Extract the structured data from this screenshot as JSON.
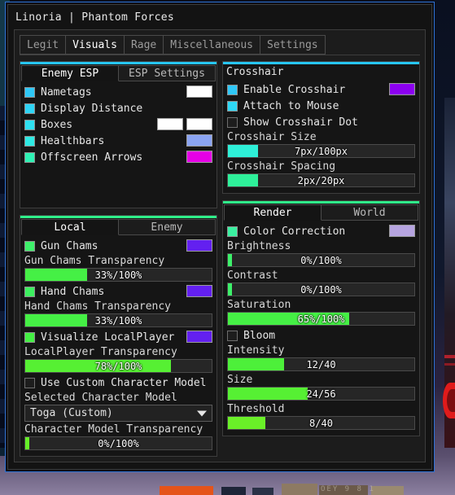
{
  "window": {
    "title": "Linoria | Phantom Forces",
    "border_color": "#2f73d8"
  },
  "main_tabs": [
    {
      "label": "Legit",
      "active": false
    },
    {
      "label": "Visuals",
      "active": true
    },
    {
      "label": "Rage",
      "active": false
    },
    {
      "label": "Miscellaneous",
      "active": false
    },
    {
      "label": "Settings",
      "active": false
    }
  ],
  "left_column": {
    "esp_group": {
      "accent_color": "#27c6f5",
      "tabs": [
        {
          "label": "Enemy ESP",
          "active": true
        },
        {
          "label": "ESP Settings",
          "active": false
        }
      ],
      "rows": [
        {
          "label": "Nametags",
          "checked": true,
          "checkbox_color": "#2fc8f7",
          "swatches": [
            "#ffffff"
          ]
        },
        {
          "label": "Display Distance",
          "checked": true,
          "checkbox_color": "#2ed4f5",
          "swatches": []
        },
        {
          "label": "Boxes",
          "checked": true,
          "checkbox_color": "#2ee0f0",
          "swatches": [
            "#ffffff",
            "#ffffff"
          ]
        },
        {
          "label": "Healthbars",
          "checked": true,
          "checkbox_color": "#2eeae4",
          "swatches": [
            "#8ba4f2"
          ]
        },
        {
          "label": "Offscreen Arrows",
          "checked": true,
          "checkbox_color": "#2ef2b4",
          "swatches": [
            "#e600e6"
          ]
        }
      ]
    },
    "chams_group": {
      "accent_color": "#2ff08a",
      "tabs": [
        {
          "label": "Local",
          "active": true
        },
        {
          "label": "Enemy",
          "active": false
        }
      ],
      "items": [
        {
          "kind": "toggle",
          "label": "Gun Chams",
          "checked": true,
          "checkbox_color": "#3df06a",
          "swatches": [
            "#6320f0"
          ]
        },
        {
          "kind": "slider",
          "caption": "Gun Chams Transparency",
          "value_text": "33%/100%",
          "percent": 33,
          "fill_color": "#45f045"
        },
        {
          "kind": "toggle",
          "label": "Hand Chams",
          "checked": true,
          "checkbox_color": "#3df060",
          "swatches": [
            "#6320f0"
          ]
        },
        {
          "kind": "slider",
          "caption": "Hand Chams Transparency",
          "value_text": "33%/100%",
          "percent": 33,
          "fill_color": "#45f045"
        },
        {
          "kind": "toggle",
          "label": "Visualize LocalPlayer",
          "checked": true,
          "checkbox_color": "#44f044",
          "swatches": [
            "#6320f0"
          ]
        },
        {
          "kind": "slider",
          "caption": "LocalPlayer Transparency",
          "value_text": "78%/100%",
          "percent": 78,
          "fill_color": "#56f033"
        },
        {
          "kind": "toggle",
          "label": "Use Custom Character Model",
          "checked": false,
          "checkbox_color": "#1d1d1d",
          "swatches": []
        },
        {
          "kind": "dropdown",
          "caption": "Selected Character Model",
          "value": "Toga (Custom)"
        },
        {
          "kind": "slider",
          "caption": "Character Model Transparency",
          "value_text": "0%/100%",
          "percent": 2,
          "fill_color": "#66f028"
        }
      ]
    }
  },
  "right_column": {
    "crosshair_group": {
      "accent_color": "#27c6f5",
      "title": "Crosshair",
      "items": [
        {
          "kind": "toggle",
          "label": "Enable Crosshair",
          "checked": true,
          "checkbox_color": "#2fc8f7",
          "swatches": [
            "#8c00f0"
          ]
        },
        {
          "kind": "toggle",
          "label": "Attach to Mouse",
          "checked": true,
          "checkbox_color": "#2ed8f5",
          "swatches": []
        },
        {
          "kind": "toggle",
          "label": "Show Crosshair Dot",
          "checked": false,
          "checkbox_color": "#1d1d1d",
          "swatches": []
        },
        {
          "kind": "slider",
          "caption": "Crosshair Size",
          "value_text": "7px/100px",
          "percent": 16,
          "fill_color": "#2ef0d8"
        },
        {
          "kind": "slider",
          "caption": "Crosshair Spacing",
          "value_text": "2px/20px",
          "percent": 16,
          "fill_color": "#2ef09a"
        }
      ]
    },
    "render_group": {
      "accent_color": "#2ff08a",
      "tabs": [
        {
          "label": "Render",
          "active": true
        },
        {
          "label": "World",
          "active": false
        }
      ],
      "items": [
        {
          "kind": "toggle",
          "label": "Color Correction",
          "checked": true,
          "checkbox_color": "#3af0a0",
          "swatches": [
            "#b6a4e0"
          ]
        },
        {
          "kind": "slider",
          "caption": "Brightness",
          "value_text": "0%/100%",
          "percent": 2,
          "fill_color": "#3df06a"
        },
        {
          "kind": "slider",
          "caption": "Contrast",
          "value_text": "0%/100%",
          "percent": 2,
          "fill_color": "#3df06a"
        },
        {
          "kind": "slider",
          "caption": "Saturation",
          "value_text": "65%/100%",
          "percent": 65,
          "fill_color": "#45f045"
        },
        {
          "kind": "toggle",
          "label": "Bloom",
          "checked": false,
          "checkbox_color": "#1d1d1d",
          "swatches": []
        },
        {
          "kind": "slider",
          "caption": "Intensity",
          "value_text": "12/40",
          "percent": 30,
          "fill_color": "#4df03a"
        },
        {
          "kind": "slider",
          "caption": "Size",
          "value_text": "24/56",
          "percent": 43,
          "fill_color": "#56f033"
        },
        {
          "kind": "slider",
          "caption": "Threshold",
          "value_text": "8/40",
          "percent": 20,
          "fill_color": "#6af028"
        }
      ]
    }
  },
  "hud": {
    "text": "OEY 9 8 1"
  }
}
